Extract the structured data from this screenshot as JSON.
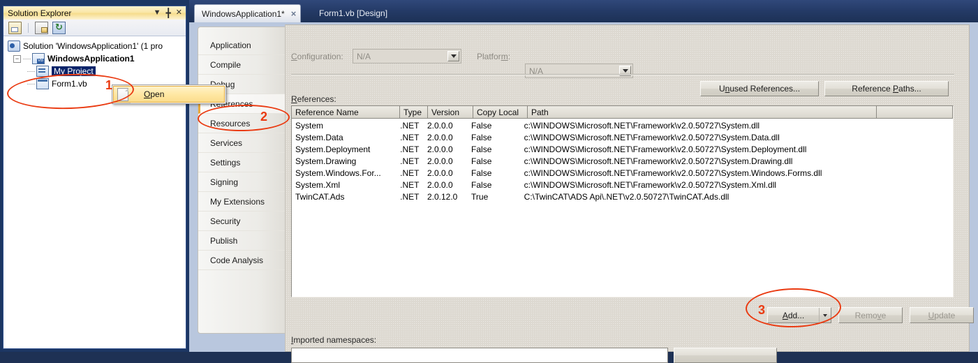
{
  "solution_explorer": {
    "title": "Solution Explorer",
    "titlebar_icons": [
      "chevron-down-icon",
      "pin-icon",
      "close-icon"
    ],
    "toolbar": [
      {
        "name": "properties-icon",
        "label": "Properties"
      },
      {
        "name": "show-all-files-icon",
        "label": "Show All Files"
      },
      {
        "name": "refresh-icon",
        "label": "Refresh"
      }
    ],
    "tree": [
      {
        "label": "Solution 'WindowsApplication1' (1 pro",
        "icon": "solution-icon",
        "indent": 1,
        "bold": false,
        "selected": false
      },
      {
        "label": "WindowsApplication1",
        "icon": "vb-project-icon",
        "indent": 2,
        "bold": true,
        "selected": false
      },
      {
        "label": "My Project",
        "icon": "my-project-icon",
        "indent": 3,
        "bold": false,
        "selected": true
      },
      {
        "label": "Form1.vb",
        "icon": "form-icon",
        "indent": 3,
        "bold": false,
        "selected": false
      }
    ]
  },
  "context_menu": {
    "items": [
      {
        "label": "Open",
        "accel": "O",
        "icon": "document-icon"
      }
    ]
  },
  "tabs": [
    {
      "label": "WindowsApplication1*",
      "active": true,
      "close": "×"
    },
    {
      "label": "Form1.vb [Design]",
      "active": false
    }
  ],
  "property_pages": {
    "sidebar": [
      "Application",
      "Compile",
      "Debug",
      "References",
      "Resources",
      "Services",
      "Settings",
      "Signing",
      "My Extensions",
      "Security",
      "Publish",
      "Code Analysis"
    ],
    "selected": "References",
    "configuration": {
      "label": "Configuration:",
      "accel": "C",
      "value": "N/A"
    },
    "platform": {
      "label": "Platform:",
      "accel": "m",
      "value": "N/A"
    },
    "references_label": "References:",
    "references_accel": "R",
    "buttons": {
      "unused_references": "Unused References...",
      "unused_references_accel": "n",
      "reference_paths": "Reference Paths...",
      "reference_paths_accel": "P",
      "add": "Add...",
      "add_accel": "A",
      "remove": "Remove",
      "remove_accel": "v",
      "update": "Update",
      "update_accel": "U"
    },
    "grid": {
      "columns": [
        "Reference Name",
        "Type",
        "Version",
        "Copy Local",
        "Path",
        ""
      ],
      "rows": [
        [
          "System",
          ".NET",
          "2.0.0.0",
          "False",
          "c:\\WINDOWS\\Microsoft.NET\\Framework\\v2.0.50727\\System.dll"
        ],
        [
          "System.Data",
          ".NET",
          "2.0.0.0",
          "False",
          "c:\\WINDOWS\\Microsoft.NET\\Framework\\v2.0.50727\\System.Data.dll"
        ],
        [
          "System.Deployment",
          ".NET",
          "2.0.0.0",
          "False",
          "c:\\WINDOWS\\Microsoft.NET\\Framework\\v2.0.50727\\System.Deployment.dll"
        ],
        [
          "System.Drawing",
          ".NET",
          "2.0.0.0",
          "False",
          "c:\\WINDOWS\\Microsoft.NET\\Framework\\v2.0.50727\\System.Drawing.dll"
        ],
        [
          "System.Windows.For...",
          ".NET",
          "2.0.0.0",
          "False",
          "c:\\WINDOWS\\Microsoft.NET\\Framework\\v2.0.50727\\System.Windows.Forms.dll"
        ],
        [
          "System.Xml",
          ".NET",
          "2.0.0.0",
          "False",
          "c:\\WINDOWS\\Microsoft.NET\\Framework\\v2.0.50727\\System.Xml.dll"
        ],
        [
          "TwinCAT.Ads",
          ".NET",
          "2.0.12.0",
          "True",
          "C:\\TwinCAT\\ADS Api\\.NET\\v2.0.50727\\TwinCAT.Ads.dll"
        ]
      ]
    },
    "imported_namespaces_label": "Imported namespaces:",
    "imported_namespaces_accel": "I"
  },
  "annotations": {
    "color": "#ea3b12",
    "markers": [
      {
        "number": "1",
        "target": "my-project-tree-item"
      },
      {
        "number": "2",
        "target": "references-sidebar-item"
      },
      {
        "number": "3",
        "target": "add-button"
      }
    ]
  }
}
